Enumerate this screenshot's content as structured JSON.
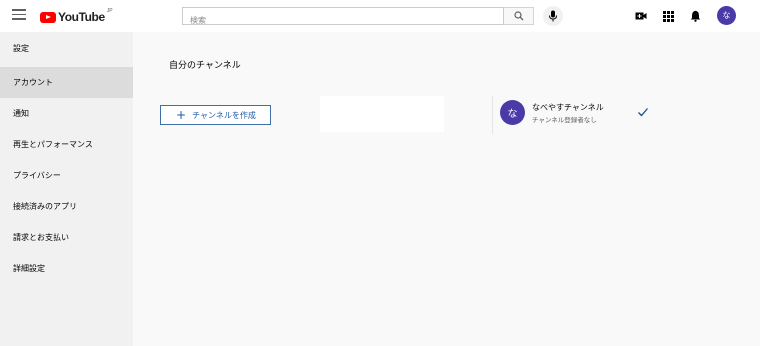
{
  "header": {
    "logo_text": "YouTube",
    "logo_region": "JP",
    "search_placeholder": "検索",
    "icons": [
      "menu-icon",
      "search-icon",
      "mic-icon",
      "create-video-icon",
      "apps-icon",
      "bell-icon"
    ],
    "avatar_initial": "な",
    "colors": {
      "brand_red": "#ff0000",
      "avatar_bg": "#4a3aa8"
    }
  },
  "sidebar": {
    "items": [
      {
        "label": "設定"
      },
      {
        "label": "アカウント"
      },
      {
        "label": "通知"
      },
      {
        "label": "再生とパフォーマンス"
      },
      {
        "label": "プライバシー"
      },
      {
        "label": "接続済みのアプリ"
      },
      {
        "label": "請求とお支払い"
      },
      {
        "label": "詳細設定"
      }
    ],
    "active_item": "アカウント"
  },
  "main": {
    "title": "自分のチャンネル",
    "create_button_label": "チャンネルを作成",
    "channel": {
      "avatar_initial": "な",
      "name": "なべやすチャンネル",
      "subscribers": "チャンネル登録者なし",
      "selected": true
    }
  }
}
